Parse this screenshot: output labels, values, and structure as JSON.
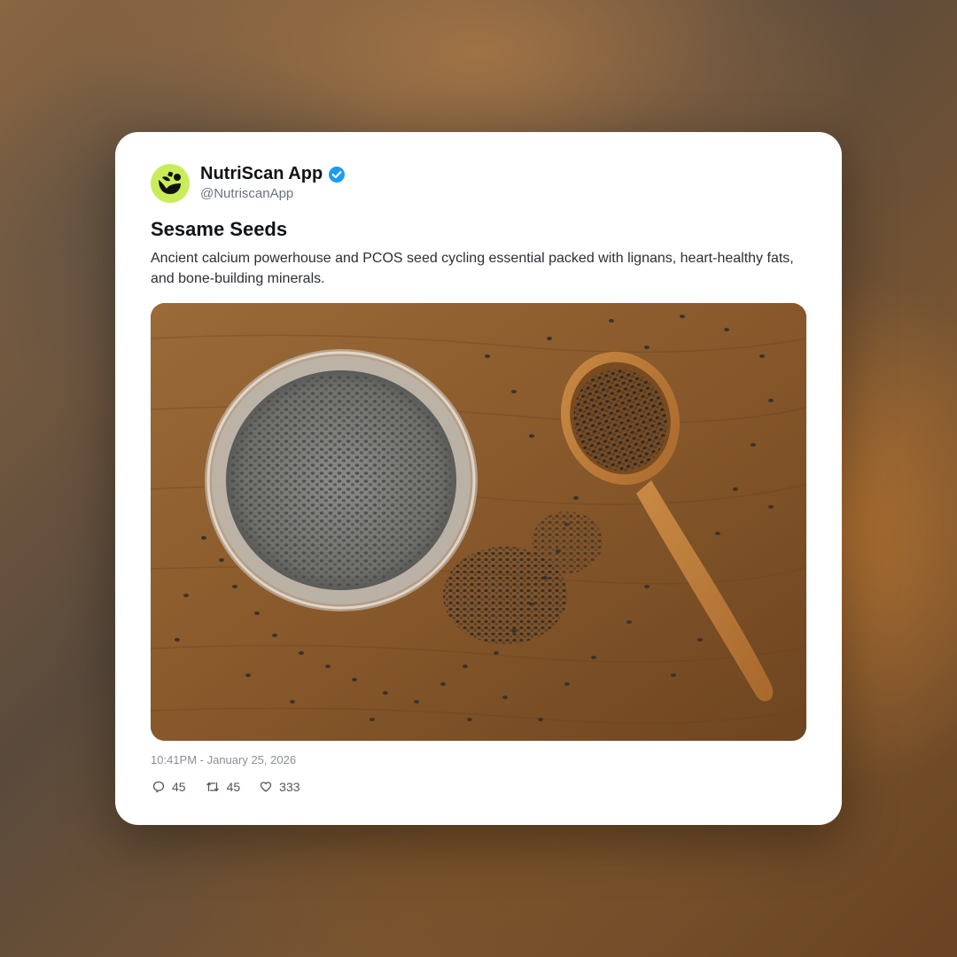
{
  "post": {
    "author_name": "NutriScan App",
    "handle": "@NutriscanApp",
    "verified": true,
    "title": "Sesame Seeds",
    "description": "Ancient calcium powerhouse and PCOS seed cycling essential packed with lignans, heart-healthy fats, and bone-building minerals.",
    "timestamp": "10:41PM - January 25, 2026",
    "image_icon": "seeds-photo",
    "stats": {
      "replies": "45",
      "reposts": "45",
      "likes": "333"
    }
  },
  "colors": {
    "avatar_bg": "#c9ec5a",
    "verified_blue": "#1d9bf0",
    "card_bg": "#ffffff"
  },
  "icons": {
    "avatar": "nutriscan-logo-icon",
    "verified": "verified-badge-icon",
    "reply": "reply-icon",
    "repost": "repost-icon",
    "like": "heart-icon"
  }
}
